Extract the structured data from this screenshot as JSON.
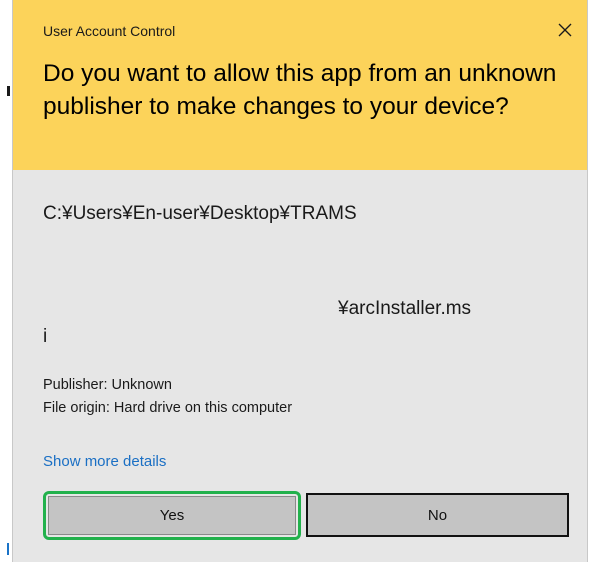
{
  "dialog": {
    "window_title": "User Account Control",
    "heading": "Do you want to allow this app from an unknown publisher to make changes to your device?",
    "file_path": {
      "line1": "C:¥Users¥En-user¥Desktop¥TRAMS",
      "line2": "¥arcInstaller.ms",
      "line3": "i"
    },
    "publisher": "Publisher: Unknown",
    "file_origin": "File origin: Hard drive on this computer",
    "show_more_label": "Show more details",
    "yes_label": "Yes",
    "no_label": "No"
  },
  "icons": {
    "close": "close-icon"
  },
  "colors": {
    "header_background": "#fcd35a",
    "body_background": "#e6e6e6",
    "link": "#1a6fc4",
    "highlight_border": "#22b14c",
    "button_background": "#c4c4c4"
  }
}
